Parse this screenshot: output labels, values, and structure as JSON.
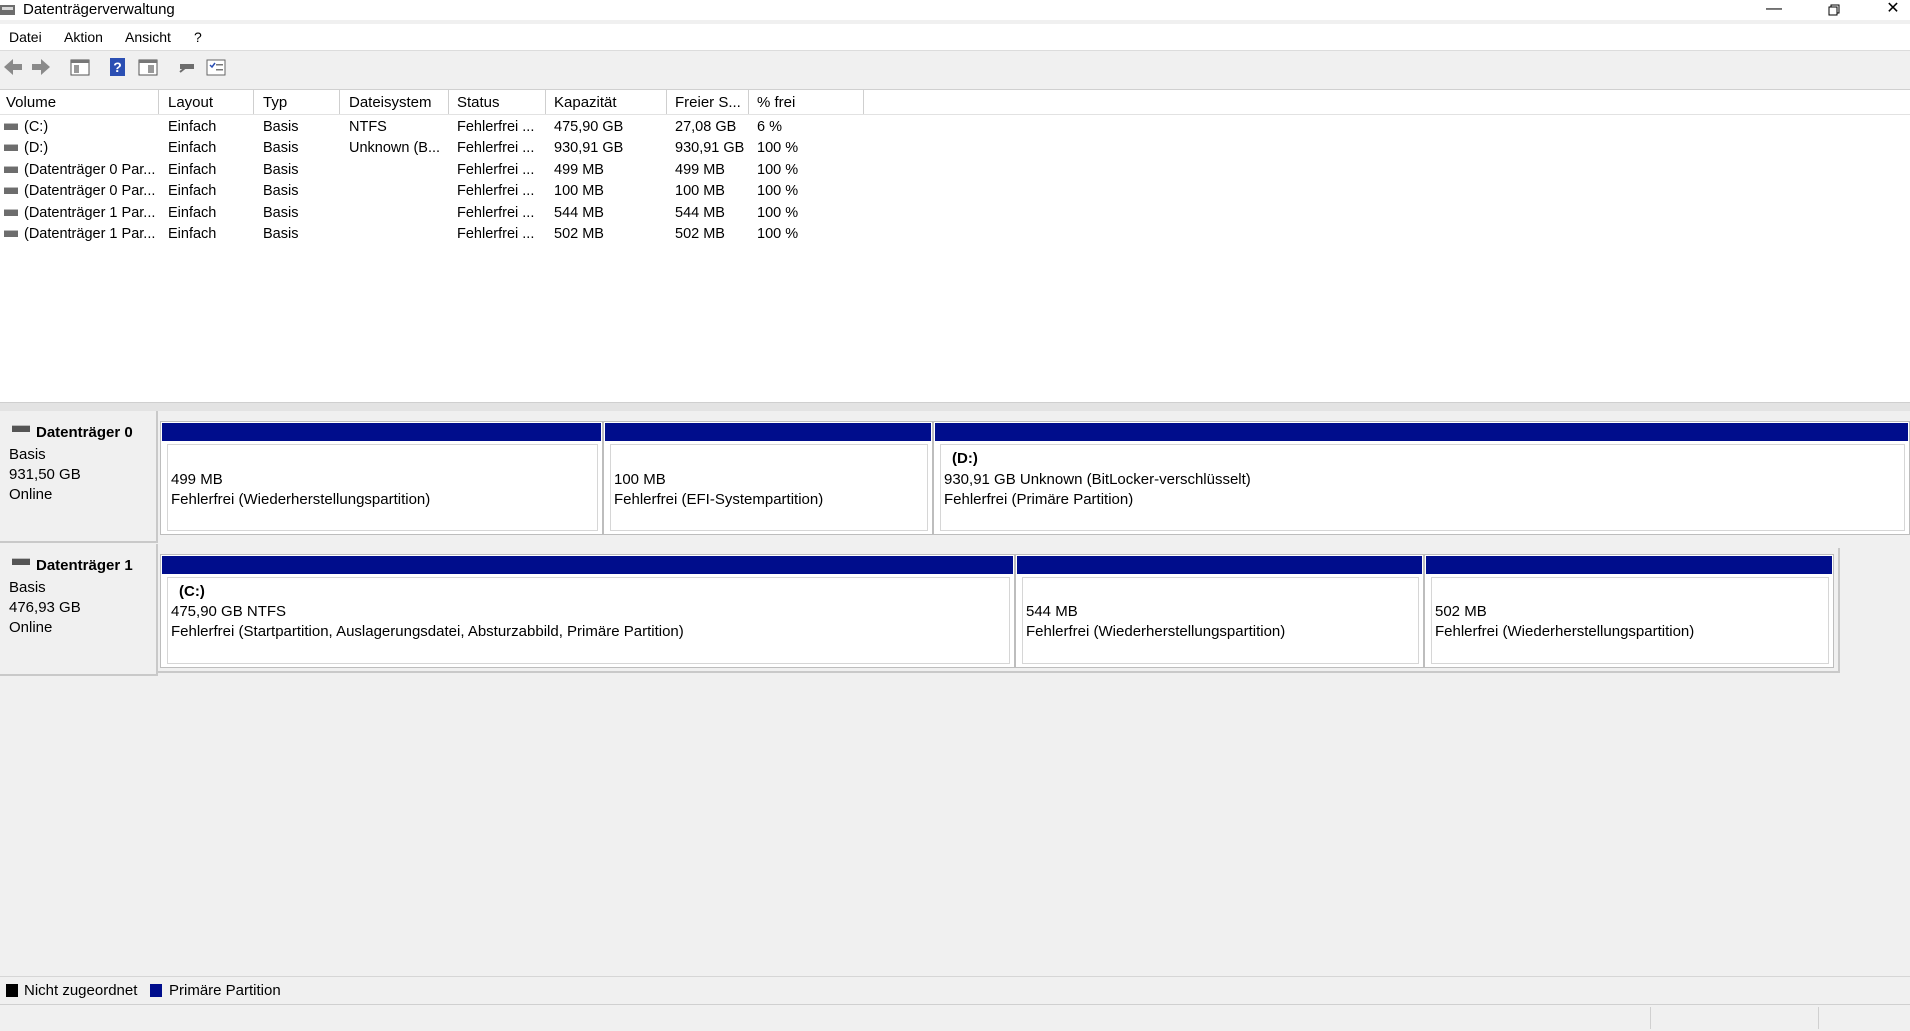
{
  "window": {
    "title": "Datenträgerverwaltung"
  },
  "menu": [
    "Datei",
    "Aktion",
    "Ansicht",
    "?"
  ],
  "toolbar": {
    "icons": [
      "back-arrow-icon",
      "forward-arrow-icon",
      "show-hide-console-tree-icon",
      "help-icon",
      "properties-icon",
      "connect-icon",
      "view-settings-icon"
    ]
  },
  "volumes": {
    "columns": [
      "Volume",
      "Layout",
      "Typ",
      "Dateisystem",
      "Status",
      "Kapazität",
      "Freier S...",
      "% frei"
    ],
    "rows": [
      [
        "(C:)",
        "Einfach",
        "Basis",
        "NTFS",
        "Fehlerfrei ...",
        "475,90 GB",
        "27,08 GB",
        "6 %"
      ],
      [
        "(D:)",
        "Einfach",
        "Basis",
        "Unknown (B...",
        "Fehlerfrei ...",
        "930,91 GB",
        "930,91 GB",
        "100 %"
      ],
      [
        "(Datenträger 0 Par...",
        "Einfach",
        "Basis",
        "",
        "Fehlerfrei ...",
        "499 MB",
        "499 MB",
        "100 %"
      ],
      [
        "(Datenträger 0 Par...",
        "Einfach",
        "Basis",
        "",
        "Fehlerfrei ...",
        "100 MB",
        "100 MB",
        "100 %"
      ],
      [
        "(Datenträger 1 Par...",
        "Einfach",
        "Basis",
        "",
        "Fehlerfrei ...",
        "544 MB",
        "544 MB",
        "100 %"
      ],
      [
        "(Datenträger 1 Par...",
        "Einfach",
        "Basis",
        "",
        "Fehlerfrei ...",
        "502 MB",
        "502 MB",
        "100 %"
      ]
    ]
  },
  "disks": [
    {
      "name": "Datenträger 0",
      "type": "Basis",
      "size": "931,50 GB",
      "state": "Online",
      "partitions": [
        {
          "title": "",
          "size": "499 MB",
          "status": "Fehlerfrei (Wiederherstellungspartition)"
        },
        {
          "title": "",
          "size": "100 MB",
          "status": "Fehlerfrei (EFI-Systempartition)"
        },
        {
          "title": "(D:)",
          "size": "930,91 GB Unknown (BitLocker-verschlüsselt)",
          "status": "Fehlerfrei (Primäre Partition)"
        }
      ]
    },
    {
      "name": "Datenträger 1",
      "type": "Basis",
      "size": "476,93 GB",
      "state": "Online",
      "partitions": [
        {
          "title": "(C:)",
          "size": "475,90 GB NTFS",
          "status": "Fehlerfrei (Startpartition, Auslagerungsdatei, Absturzabbild, Primäre Partition)"
        },
        {
          "title": "",
          "size": "544 MB",
          "status": "Fehlerfrei (Wiederherstellungspartition)"
        },
        {
          "title": "",
          "size": "502 MB",
          "status": "Fehlerfrei (Wiederherstellungspartition)"
        }
      ]
    }
  ],
  "legend": [
    {
      "label": "Nicht zugeordnet",
      "color": "#000000"
    },
    {
      "label": "Primäre Partition",
      "color": "#000d8c"
    }
  ],
  "colors": {
    "partition_bar": "#000d8c",
    "unallocated": "#000000"
  }
}
